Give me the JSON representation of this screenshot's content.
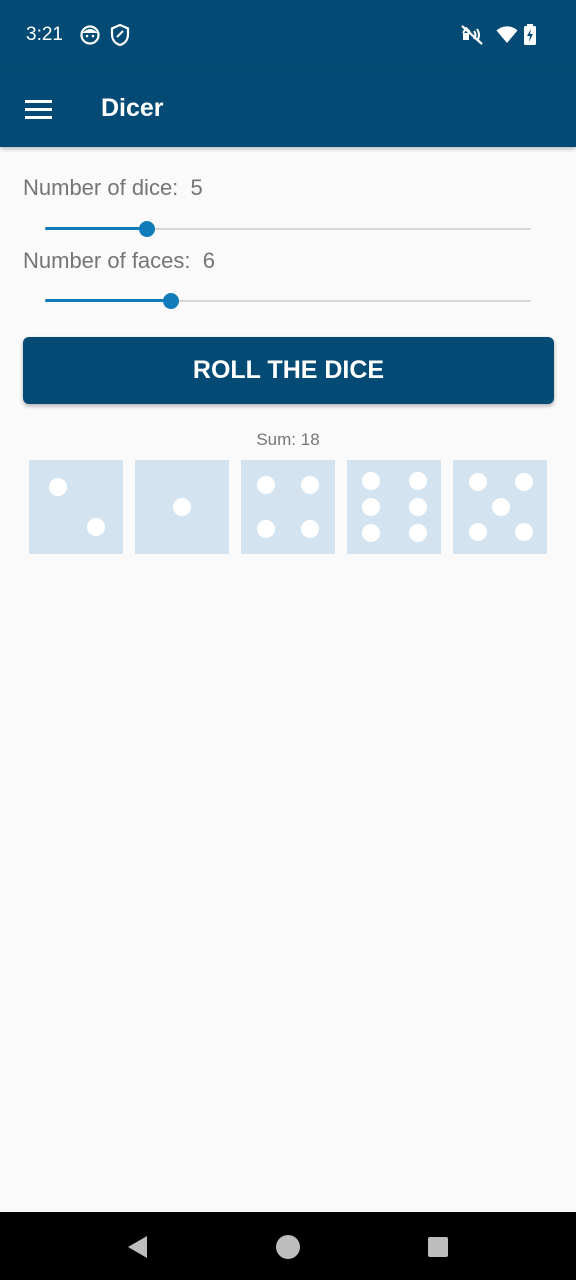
{
  "status_bar": {
    "time": "3:21",
    "left_icons": [
      "face-icon",
      "shield-icon"
    ],
    "right_icons": [
      "vibrate-off-icon",
      "wifi-icon",
      "battery-charging-icon"
    ]
  },
  "app_bar": {
    "menu_icon": "hamburger-menu-icon",
    "title": "Dicer"
  },
  "settings": {
    "dice_label": "Number of dice:  5",
    "dice_value": 5,
    "dice_slider_fraction": 0.21,
    "faces_label": "Number of faces:  6",
    "faces_value": 6,
    "faces_slider_fraction": 0.26
  },
  "roll_button_label": "ROLL THE DICE",
  "sum_text": "Sum: 18",
  "dice": [
    2,
    1,
    4,
    6,
    5
  ],
  "nav_bar": {
    "icons": [
      "back-icon",
      "home-icon",
      "recents-icon"
    ]
  },
  "colors": {
    "primary": "#034b74",
    "accent": "#0f7bb8",
    "die_face": "#d3e3ef",
    "pip": "#ffffff",
    "background": "#fafafa"
  }
}
